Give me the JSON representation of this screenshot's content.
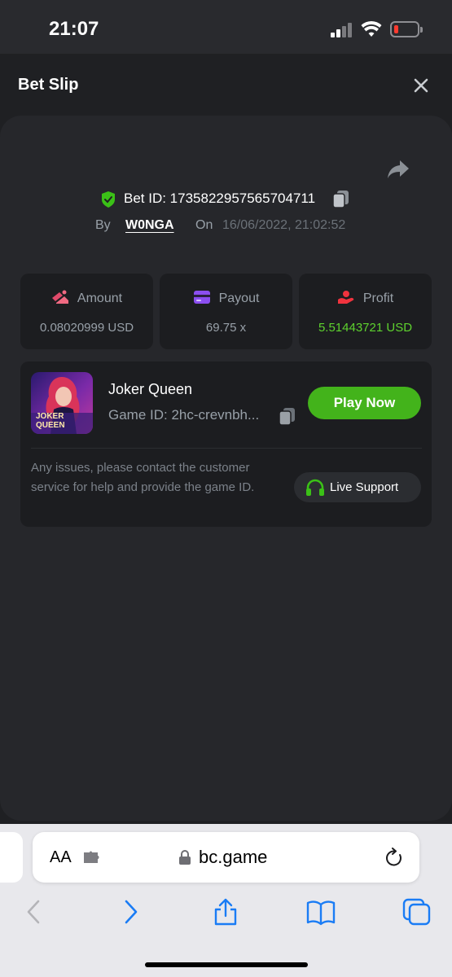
{
  "status_bar": {
    "time": "21:07"
  },
  "header": {
    "title": "Bet Slip"
  },
  "bet": {
    "bet_id_label": "Bet ID: 1735822957565704711",
    "by_label": "By",
    "username": "W0NGA",
    "on_label": "On",
    "datetime": "16/06/2022, 21:02:52"
  },
  "stats": [
    {
      "label": "Amount",
      "value": "0.08020999 USD",
      "icon": "amount-icon"
    },
    {
      "label": "Payout",
      "value": "69.75 x",
      "icon": "payout-card-icon"
    },
    {
      "label": "Profit",
      "value": "5.51443721 USD",
      "icon": "profit-icon"
    }
  ],
  "game": {
    "name": "Joker Queen",
    "game_id": "Game ID: 2hc-crevnbh...",
    "play_label": "Play Now",
    "thumb_text_1": "JOKER",
    "thumb_text_2": "QUEEN",
    "help_text": "Any issues, please contact the customer service for help and provide the game ID.",
    "support_label": "Live Support"
  },
  "browser": {
    "aa_label": "AA",
    "domain": "bc.game"
  },
  "colors": {
    "accent_green": "#43b31b",
    "profit_green": "#5ed22e",
    "panel": "#26272b",
    "card": "#1c1d20"
  }
}
